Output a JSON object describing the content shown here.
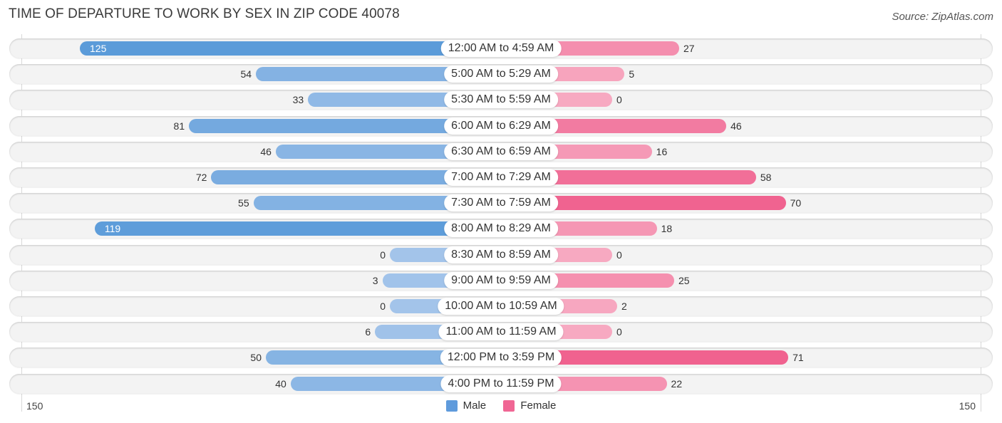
{
  "title": "TIME OF DEPARTURE TO WORK BY SEX IN ZIP CODE 40078",
  "source": "Source: ZipAtlas.com",
  "colors": {
    "male": "#5b9bd9",
    "male_light": "#a3c4ea",
    "female": "#f0628f",
    "female_light": "#f7a9c1",
    "row_bg": "#f3f3f3"
  },
  "legend": [
    {
      "label": "Male",
      "color": "#5f9bdc"
    },
    {
      "label": "Female",
      "color": "#f06694"
    }
  ],
  "chart_data": {
    "type": "bar",
    "orientation": "horizontal-diverging",
    "title": "TIME OF DEPARTURE TO WORK BY SEX IN ZIP CODE 40078",
    "categories": [
      "12:00 AM to 4:59 AM",
      "5:00 AM to 5:29 AM",
      "5:30 AM to 5:59 AM",
      "6:00 AM to 6:29 AM",
      "6:30 AM to 6:59 AM",
      "7:00 AM to 7:29 AM",
      "7:30 AM to 7:59 AM",
      "8:00 AM to 8:29 AM",
      "8:30 AM to 8:59 AM",
      "9:00 AM to 9:59 AM",
      "10:00 AM to 10:59 AM",
      "11:00 AM to 11:59 AM",
      "12:00 PM to 3:59 PM",
      "4:00 PM to 11:59 PM"
    ],
    "series": [
      {
        "name": "Male",
        "values": [
          125,
          54,
          33,
          81,
          46,
          72,
          55,
          119,
          0,
          3,
          0,
          6,
          50,
          40
        ]
      },
      {
        "name": "Female",
        "values": [
          27,
          5,
          0,
          46,
          16,
          58,
          70,
          18,
          0,
          25,
          2,
          0,
          71,
          22
        ]
      }
    ],
    "axis": {
      "left_label": "150",
      "right_label": "150",
      "range": [
        0,
        150
      ]
    },
    "legend_position": "bottom-center"
  }
}
